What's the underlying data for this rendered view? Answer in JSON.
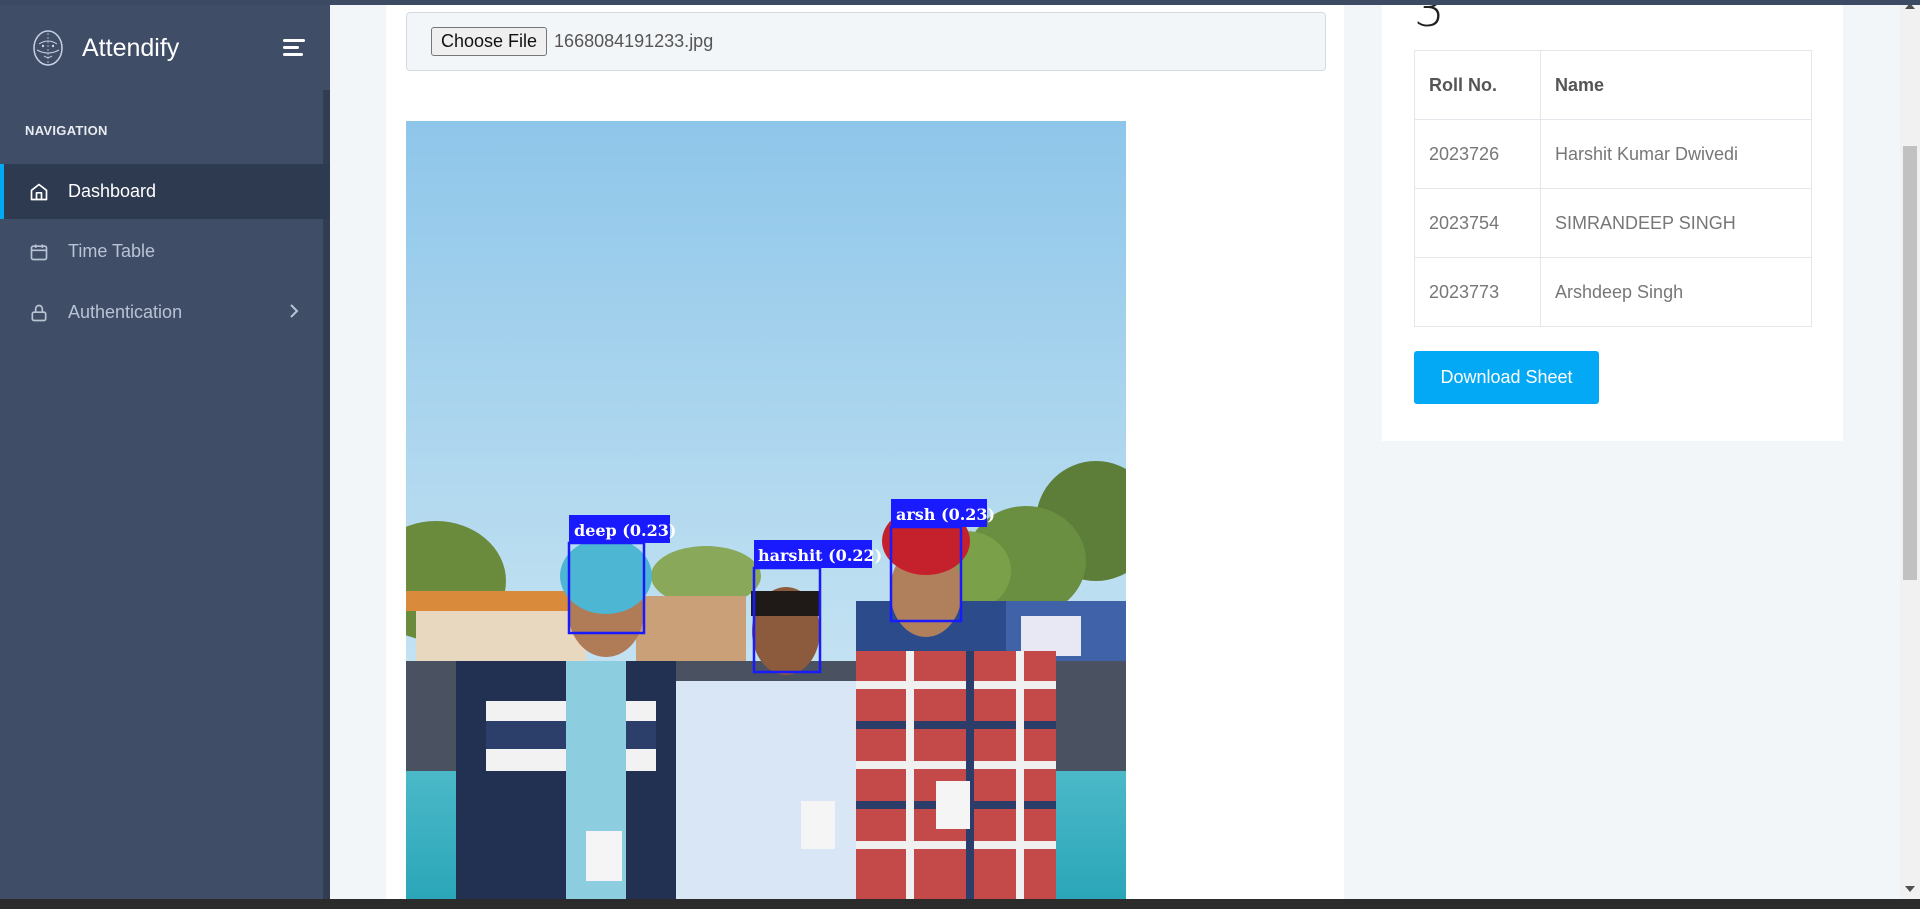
{
  "app": {
    "brand_name": "Attendify"
  },
  "sidebar": {
    "nav_caption": "NAVIGATION",
    "items": [
      {
        "label": "Dashboard",
        "icon": "home-icon",
        "active": true
      },
      {
        "label": "Time Table",
        "icon": "calendar-icon"
      },
      {
        "label": "Authentication",
        "icon": "lock-icon",
        "has_submenu": true
      }
    ]
  },
  "upload": {
    "button_label": "Choose File",
    "file_name": "1668084191233.jpg"
  },
  "detections": [
    {
      "label": "deep (0.23)"
    },
    {
      "label": "harshit (0.22)"
    },
    {
      "label": "arsh (0.23)"
    }
  ],
  "attendance": {
    "count": "3",
    "columns": [
      "Roll No.",
      "Name"
    ],
    "rows": [
      {
        "roll": "2023726",
        "name": "Harshit Kumar Dwivedi"
      },
      {
        "roll": "2023754",
        "name": "SIMRANDEEP SINGH"
      },
      {
        "roll": "2023773",
        "name": "Arshdeep Singh"
      }
    ],
    "download_label": "Download Sheet"
  },
  "colors": {
    "sidebar_bg": "#3f4d67",
    "accent": "#04a9f5",
    "detection_box": "#1a1aff"
  }
}
